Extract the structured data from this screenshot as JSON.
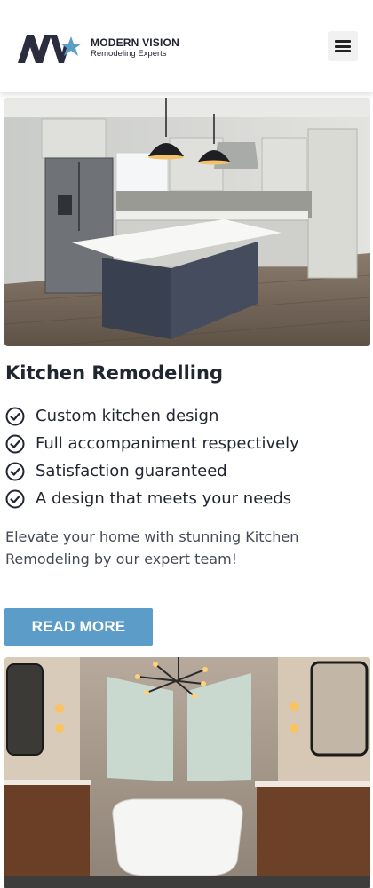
{
  "header": {
    "brand_name": "MODERN VISION",
    "brand_tagline": "Remodeling Experts",
    "logo_initials": "MV",
    "menu_icon": "hamburger-menu-icon"
  },
  "service": {
    "image_subject": "kitchen photo",
    "title": "Kitchen Remodelling",
    "features": [
      "Custom kitchen design",
      "Full accompaniment respectively",
      "Satisfaction guaranteed",
      "A design that meets your needs"
    ],
    "feature_icon": "check-circle-icon",
    "description": "Elevate your home with stunning Kitchen Remodeling by our expert team!",
    "cta_label": "READ MORE"
  },
  "next_service": {
    "image_subject": "bathroom photo"
  },
  "colors": {
    "brand_dark": "#2b2d3f",
    "brand_accent": "#5b9cc9",
    "button_bg": "#5b9cc9",
    "text": "#222631"
  }
}
